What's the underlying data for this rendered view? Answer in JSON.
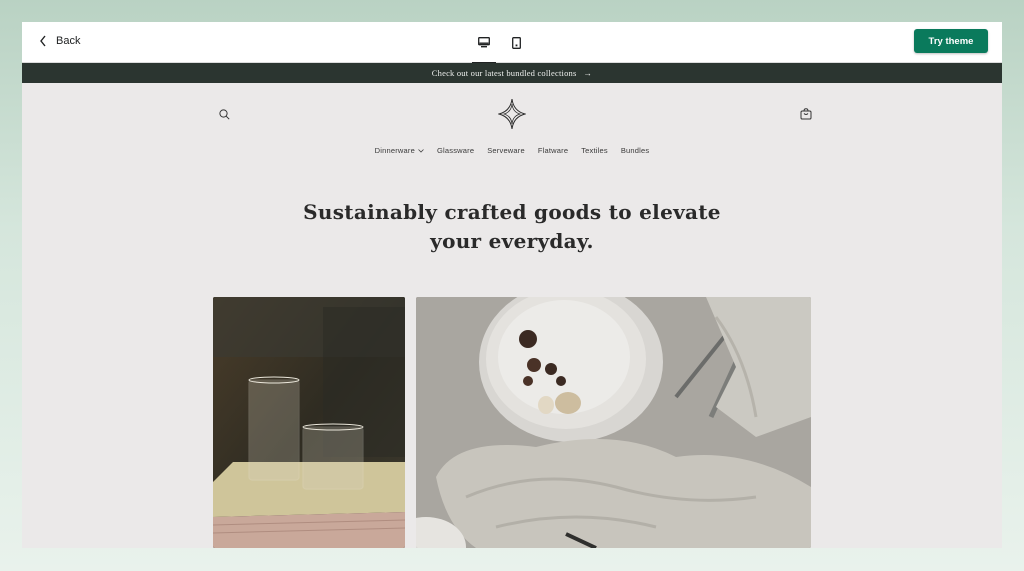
{
  "topbar": {
    "back_label": "Back",
    "try_label": "Try theme",
    "devices": [
      "desktop-icon",
      "mobile-icon"
    ]
  },
  "announcement": {
    "text": "Check out our latest bundled collections",
    "arrow": "→"
  },
  "nav": {
    "items": [
      "Dinnerware",
      "Glassware",
      "Serveware",
      "Flatware",
      "Textiles",
      "Bundles"
    ]
  },
  "hero": {
    "headline_line1": "Sustainably crafted goods to elevate",
    "headline_line2": "your everyday."
  },
  "colors": {
    "accent": "#0a7a5c",
    "announce_bg": "#2b3530",
    "page_bg": "#ebe9e9"
  }
}
